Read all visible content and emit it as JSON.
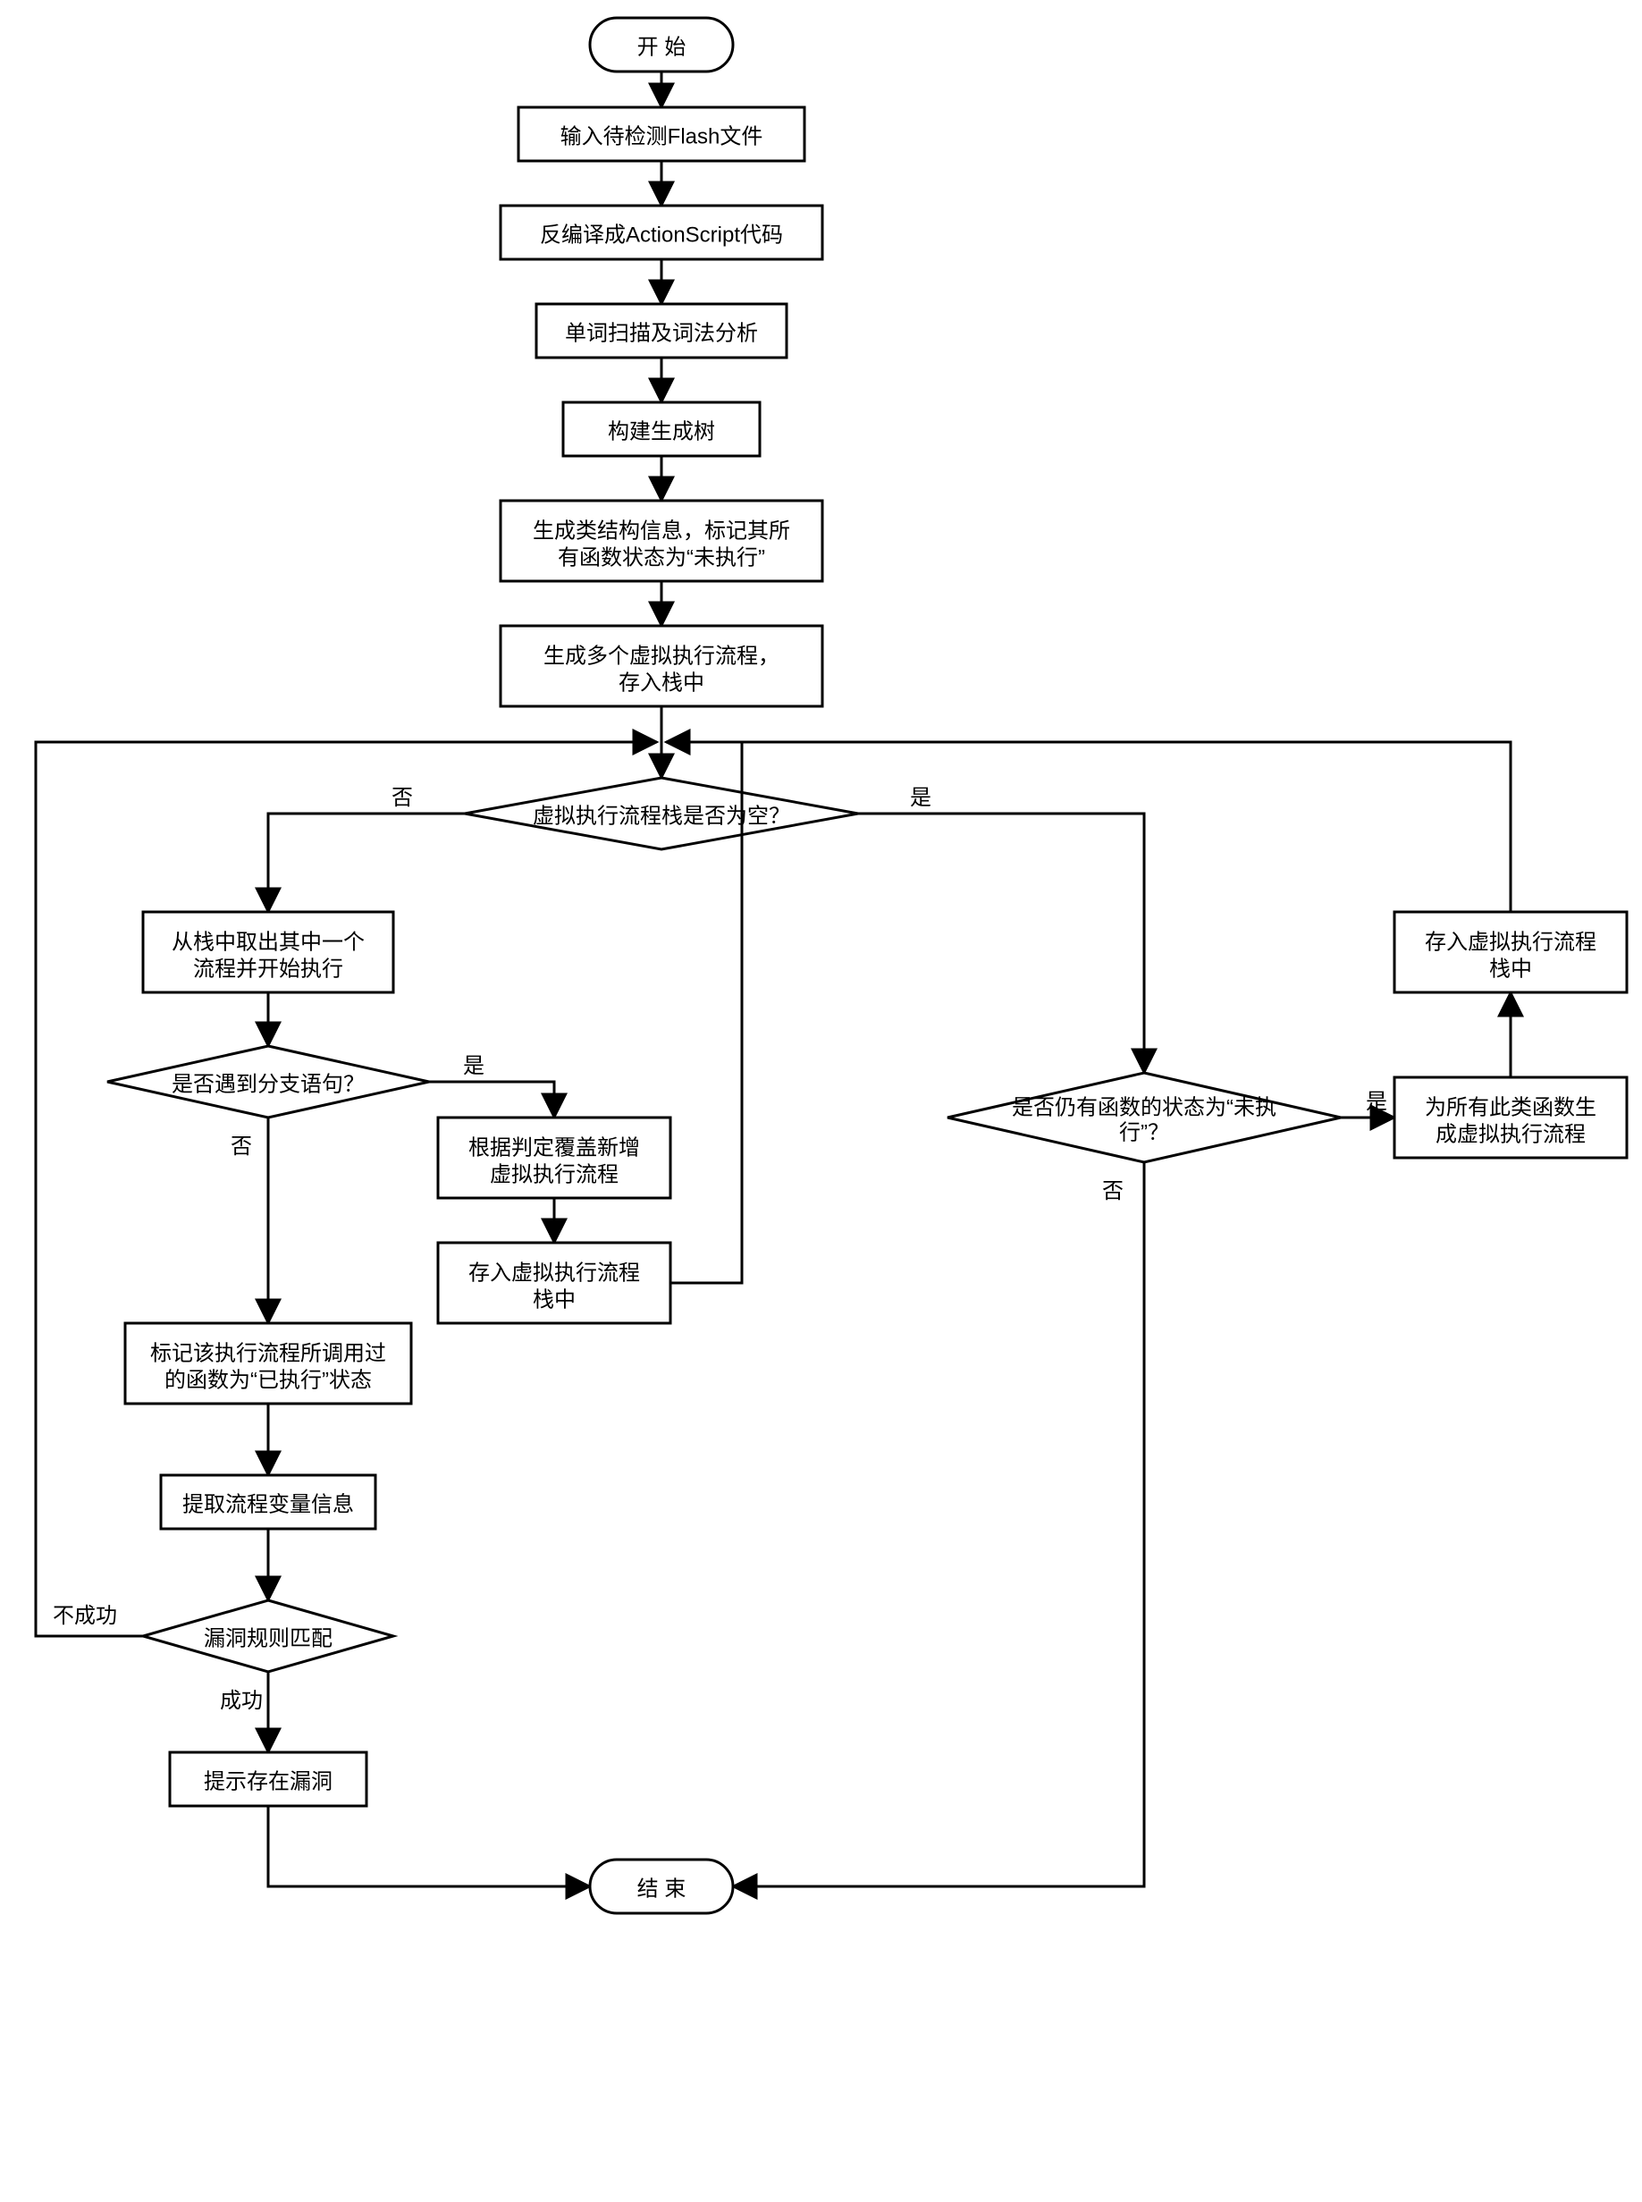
{
  "chart_data": {
    "type": "flowchart",
    "title": "",
    "nodes": [
      {
        "id": "start",
        "type": "terminator",
        "text": "开  始"
      },
      {
        "id": "n1",
        "type": "process",
        "text": "输入待检测Flash文件"
      },
      {
        "id": "n2",
        "type": "process",
        "text": "反编译成ActionScript代码"
      },
      {
        "id": "n3",
        "type": "process",
        "text": "单词扫描及词法分析"
      },
      {
        "id": "n4",
        "type": "process",
        "text": "构建生成树"
      },
      {
        "id": "n5",
        "type": "process",
        "text": "生成类结构信息，标记其所有函数状态为\"未执行\""
      },
      {
        "id": "n6",
        "type": "process",
        "text": "生成多个虚拟执行流程，存入栈中"
      },
      {
        "id": "d1",
        "type": "decision",
        "text": "虚拟执行流程栈是否为空？"
      },
      {
        "id": "n7",
        "type": "process",
        "text": "从栈中取出其中一个流程并开始执行"
      },
      {
        "id": "d2",
        "type": "decision",
        "text": "是否遇到分支语句？"
      },
      {
        "id": "n8",
        "type": "process",
        "text": "根据判定覆盖新增虚拟执行流程"
      },
      {
        "id": "n9",
        "type": "process",
        "text": "存入虚拟执行流程栈中"
      },
      {
        "id": "n10",
        "type": "process",
        "text": "标记该执行流程所调用过的函数为\"已执行\"状态"
      },
      {
        "id": "n11",
        "type": "process",
        "text": "提取流程变量信息"
      },
      {
        "id": "d3",
        "type": "decision",
        "text": "漏洞规则匹配"
      },
      {
        "id": "n12",
        "type": "process",
        "text": "提示存在漏洞"
      },
      {
        "id": "d4",
        "type": "decision",
        "text": "是否仍有函数的状态为\"未执行\"？"
      },
      {
        "id": "n13",
        "type": "process",
        "text": "为所有此类函数生成虚拟执行流程"
      },
      {
        "id": "n14",
        "type": "process",
        "text": "存入虚拟执行流程栈中"
      },
      {
        "id": "end",
        "type": "terminator",
        "text": "结  束"
      }
    ],
    "edges": [
      {
        "from": "start",
        "to": "n1"
      },
      {
        "from": "n1",
        "to": "n2"
      },
      {
        "from": "n2",
        "to": "n3"
      },
      {
        "from": "n3",
        "to": "n4"
      },
      {
        "from": "n4",
        "to": "n5"
      },
      {
        "from": "n5",
        "to": "n6"
      },
      {
        "from": "n6",
        "to": "d1"
      },
      {
        "from": "d1",
        "to": "n7",
        "label": "否"
      },
      {
        "from": "d1",
        "to": "d4",
        "label": "是"
      },
      {
        "from": "n7",
        "to": "d2"
      },
      {
        "from": "d2",
        "to": "n8",
        "label": "是"
      },
      {
        "from": "d2",
        "to": "n10",
        "label": "否"
      },
      {
        "from": "n8",
        "to": "n9"
      },
      {
        "from": "n9",
        "to": "d1",
        "label": "loop-back"
      },
      {
        "from": "n10",
        "to": "n11"
      },
      {
        "from": "n11",
        "to": "d3"
      },
      {
        "from": "d3",
        "to": "n12",
        "label": "成功"
      },
      {
        "from": "d3",
        "to": "d1",
        "label": "不成功",
        "note": "loop-back via left frame"
      },
      {
        "from": "n12",
        "to": "end"
      },
      {
        "from": "d4",
        "to": "n13",
        "label": "是"
      },
      {
        "from": "d4",
        "to": "end",
        "label": "否"
      },
      {
        "from": "n13",
        "to": "n14"
      },
      {
        "from": "n14",
        "to": "d1",
        "label": "loop-back via right frame"
      }
    ],
    "edge_labels": {
      "yes": "是",
      "no": "否",
      "success": "成功",
      "fail": "不成功"
    }
  }
}
